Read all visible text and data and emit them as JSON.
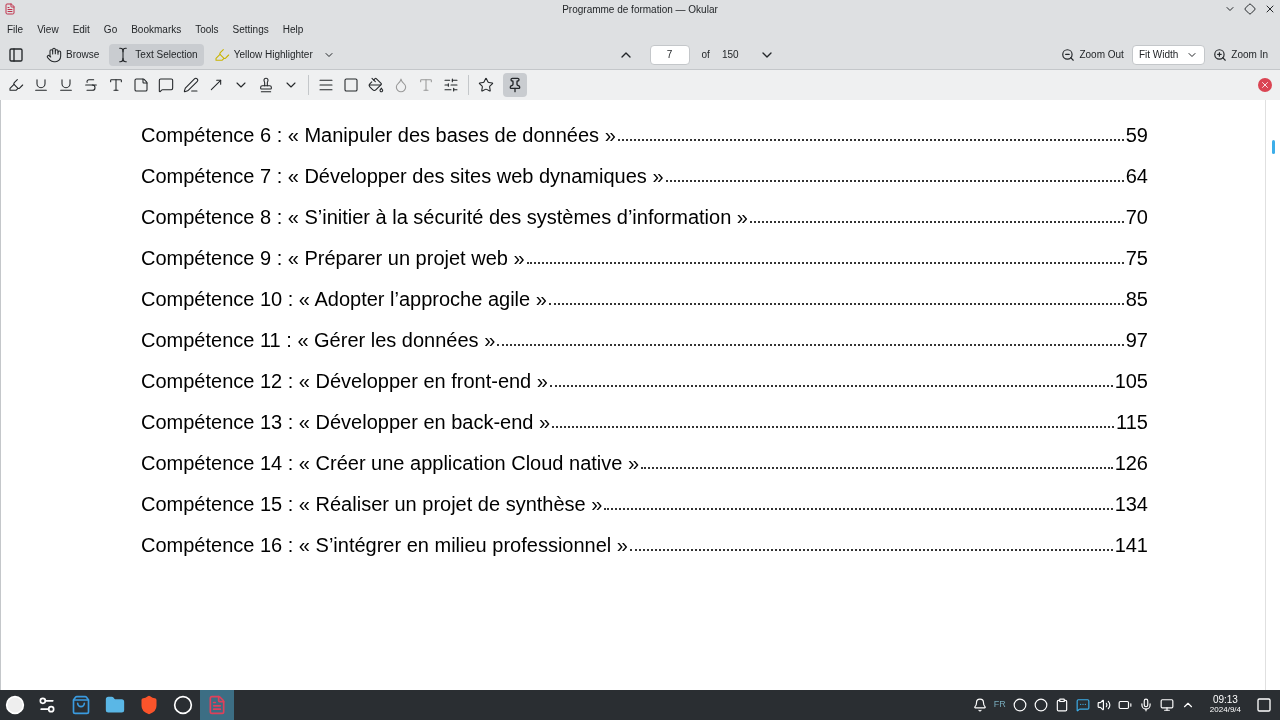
{
  "window": {
    "title": "Programme de formation — Okular"
  },
  "menu": [
    "File",
    "View",
    "Edit",
    "Go",
    "Bookmarks",
    "Tools",
    "Settings",
    "Help"
  ],
  "tools": [
    {
      "label": "Browse",
      "selected": false
    },
    {
      "label": "Text Selection",
      "selected": true
    },
    {
      "label": "Yellow Highlighter",
      "selected": false
    }
  ],
  "page_nav": {
    "value": "7",
    "of": "of",
    "total": "150"
  },
  "zoom": {
    "zoom_out": "Zoom Out",
    "mode": "Fit Width",
    "zoom_in": "Zoom In"
  },
  "annotation_pin": {
    "selected": true
  },
  "toc": [
    {
      "label": "Compétence 6 : « Manipuler des bases de données »",
      "page": "59"
    },
    {
      "label": "Compétence 7 : « Développer des sites web dynamiques »",
      "page": "64"
    },
    {
      "label": "Compétence 8 : « S’initier à la sécurité des systèmes d’information »",
      "page": "70"
    },
    {
      "label": "Compétence 9 : « Préparer un projet web »",
      "page": "75"
    },
    {
      "label": "Compétence 10 : « Adopter l’approche agile »",
      "page": "85"
    },
    {
      "label": "Compétence 11 : « Gérer les données »",
      "page": "97"
    },
    {
      "label": "Compétence 12 : « Développer en front-end »",
      "page": "105"
    },
    {
      "label": "Compétence 13 : « Développer en back-end »",
      "page": "115"
    },
    {
      "label": "Compétence 14 : « Créer une application Cloud native »",
      "page": "126"
    },
    {
      "label": "Compétence 15 : « Réaliser un projet de synthèse »",
      "page": "134"
    },
    {
      "label": "Compétence 16 : « S’intégrer en milieu professionnel »",
      "page": "141"
    }
  ],
  "taskbar": {
    "apps": [
      {
        "kind": "settings",
        "selected": false
      },
      {
        "kind": "store",
        "selected": false
      },
      {
        "kind": "folder",
        "selected": false
      },
      {
        "kind": "browser",
        "selected": false
      },
      {
        "kind": "recorder",
        "selected": false
      },
      {
        "kind": "okular",
        "selected": true
      }
    ],
    "keyboard_layout": "FR",
    "time": "09:13",
    "date": "2024/9/4"
  }
}
